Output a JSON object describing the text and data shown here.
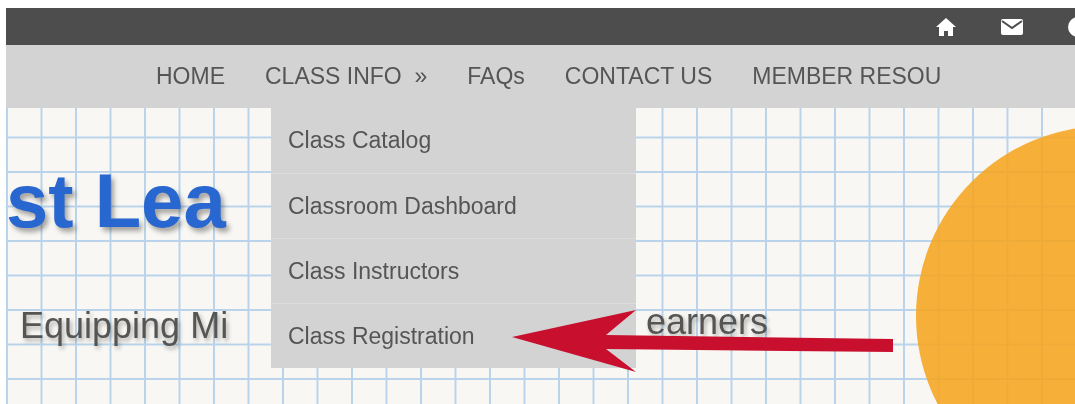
{
  "nav": {
    "items": [
      {
        "label": "HOME"
      },
      {
        "label": "CLASS INFO",
        "suffix": "»",
        "dropdown": [
          "Class Catalog",
          "Classroom Dashboard",
          "Class Instructors",
          "Class Registration"
        ]
      },
      {
        "label": "FAQs"
      },
      {
        "label": "CONTACT US"
      },
      {
        "label": "MEMBER RESOU"
      }
    ]
  },
  "hero": {
    "title": "st Lea",
    "subtitle": "Equipping Mi",
    "subtitle_tail": "earners"
  }
}
